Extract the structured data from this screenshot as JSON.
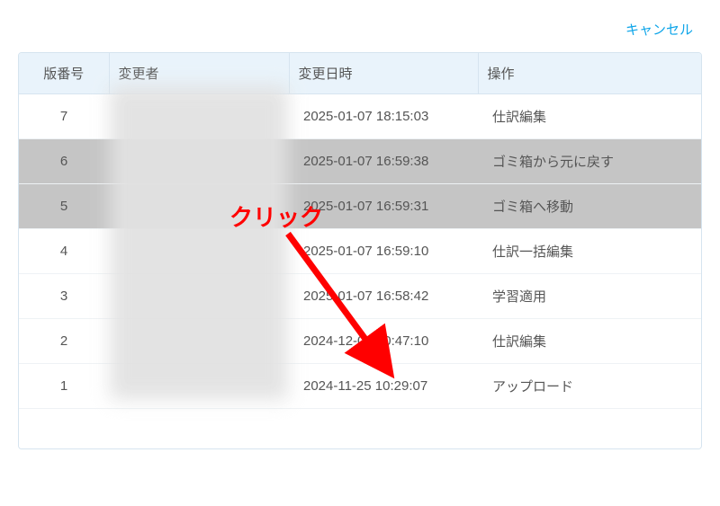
{
  "header": {
    "cancel_label": "キャンセル"
  },
  "table": {
    "headers": {
      "version": "版番号",
      "user": "変更者",
      "datetime": "変更日時",
      "action": "操作"
    },
    "rows": [
      {
        "version": "7",
        "user": "",
        "datetime": "2025-01-07 18:15:03",
        "action": "仕訳編集",
        "highlight": false
      },
      {
        "version": "6",
        "user": "",
        "datetime": "2025-01-07 16:59:38",
        "action": "ゴミ箱から元に戻す",
        "highlight": true
      },
      {
        "version": "5",
        "user": "",
        "datetime": "2025-01-07 16:59:31",
        "action": "ゴミ箱へ移動",
        "highlight": true
      },
      {
        "version": "4",
        "user": "",
        "datetime": "2025-01-07 16:59:10",
        "action": "仕訳一括編集",
        "highlight": false
      },
      {
        "version": "3",
        "user": "",
        "datetime": "2025-01-07 16:58:42",
        "action": "学習適用",
        "highlight": false
      },
      {
        "version": "2",
        "user": "",
        "datetime": "2024-12-04 10:47:10",
        "action": "仕訳編集",
        "highlight": false
      },
      {
        "version": "1",
        "user": "",
        "datetime": "2024-11-25 10:29:07",
        "action": "アップロード",
        "highlight": false
      }
    ]
  },
  "annotation": {
    "click_label": "クリック"
  }
}
